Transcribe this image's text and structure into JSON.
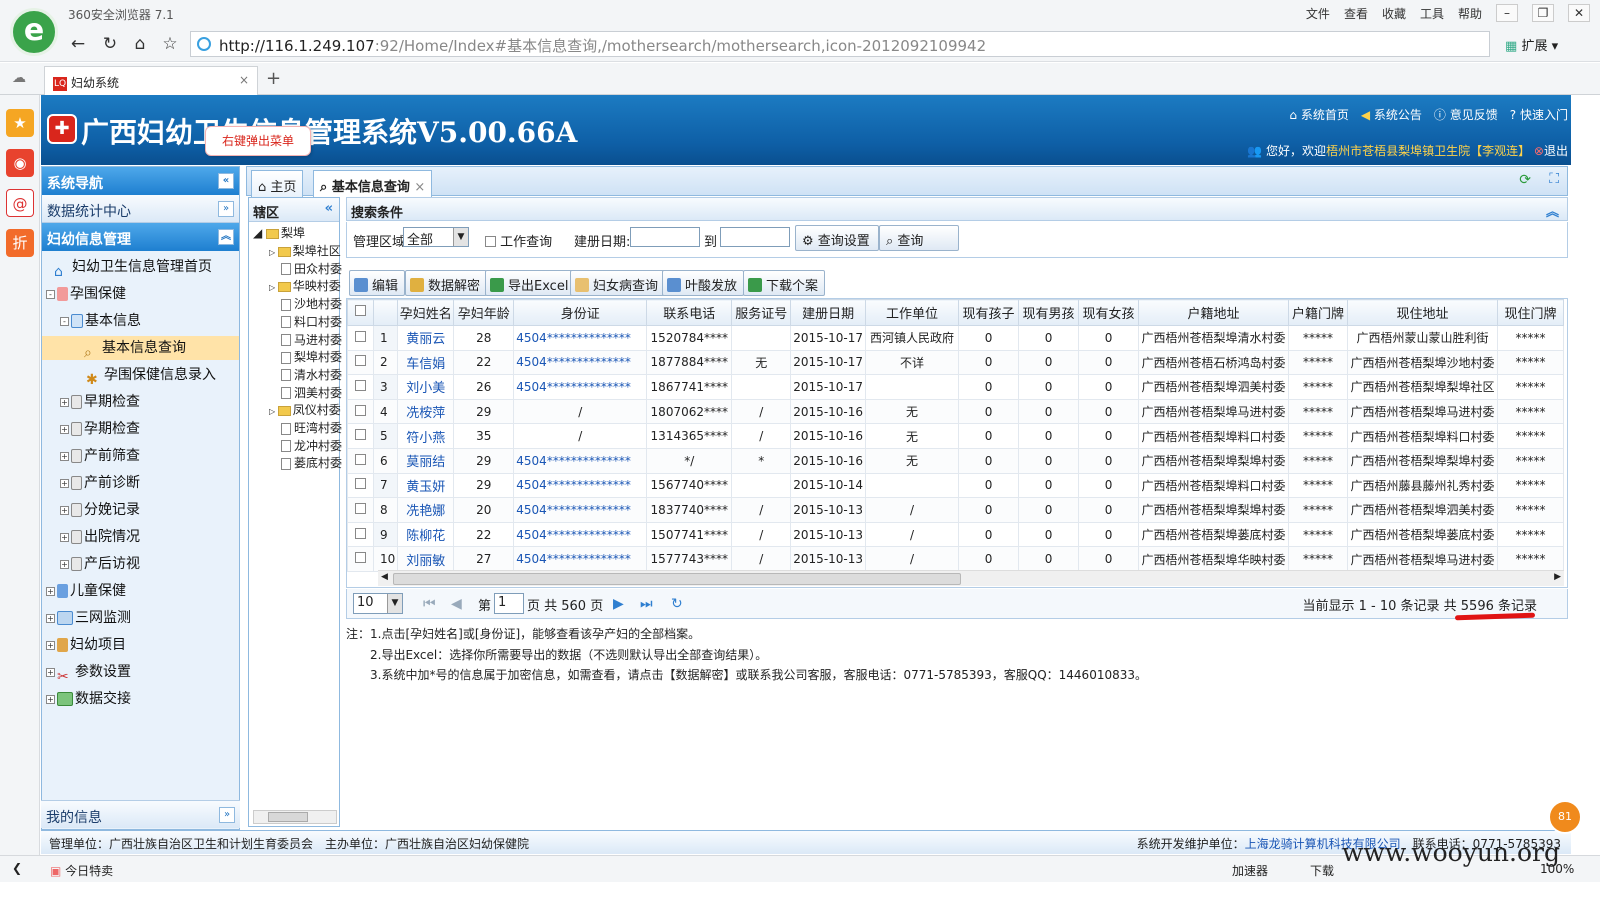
{
  "browser": {
    "title": "360安全浏览器 7.1",
    "menu": [
      "文件",
      "查看",
      "收藏",
      "工具",
      "帮助"
    ],
    "url_host": "http://116.1.249.107",
    "url_rest": ":92/Home/Index#基本信息查询,/mothersearch/mothersearch,icon-2012092109942",
    "ext_label": "扩展",
    "tab_label": "妇幼系统",
    "statusbar": {
      "left": "今日特卖",
      "items": [
        "加速器",
        "下载",
        "100%"
      ]
    }
  },
  "app": {
    "title": "广西妇幼卫生信息管理系统V5.00.66A",
    "context_tip": "右键弹出菜单",
    "top_links": [
      "系统首页",
      "系统公告",
      "意见反馈",
      "快速入门"
    ],
    "welcome_prefix": "您好，欢迎",
    "welcome_org": "梧州市苍梧县梨埠镇卫生院",
    "welcome_user": "【李观连】",
    "logout": "退出"
  },
  "nav": {
    "header": "系统导航",
    "stat_center": "数据统计中心",
    "section": "妇幼信息管理",
    "tree": [
      {
        "label": "妇幼卫生信息管理首页"
      },
      {
        "label": "孕围保健"
      },
      {
        "label": "基本信息"
      },
      {
        "label": "基本信息查询"
      },
      {
        "label": "孕围保健信息录入"
      },
      {
        "label": "早期检查"
      },
      {
        "label": "孕期检查"
      },
      {
        "label": "产前筛查"
      },
      {
        "label": "产前诊断"
      },
      {
        "label": "分娩记录"
      },
      {
        "label": "出院情况"
      },
      {
        "label": "产后访视"
      },
      {
        "label": "儿童保健"
      },
      {
        "label": "三网监测"
      },
      {
        "label": "妇幼项目"
      },
      {
        "label": "参数设置"
      },
      {
        "label": "数据交接"
      }
    ],
    "myinfo": "我的信息"
  },
  "tabs": {
    "home": "主页",
    "query": "基本信息查询"
  },
  "region": {
    "header": "辖区",
    "root": "梨埠",
    "nodes": [
      "梨埠社区",
      "田众村委",
      "华映村委",
      "沙地村委",
      "料口村委",
      "马进村委",
      "梨埠村委",
      "清水村委",
      "泗美村委",
      "凤仪村委",
      "旺湾村委",
      "龙冲村委",
      "蒌底村委"
    ]
  },
  "search": {
    "header": "搜索条件",
    "area_label": "管理区域:",
    "area_value": "全部",
    "work_label": "工作查询",
    "date_label": "建册日期:",
    "to_label": "到",
    "settings_btn": "查询设置",
    "query_btn": "查询"
  },
  "toolbar": {
    "edit": "编辑",
    "decrypt": "数据解密",
    "export": "导出Excel",
    "gyn": "妇女病查询",
    "folic": "叶酸发放",
    "download": "下载个案"
  },
  "grid": {
    "columns": [
      "孕妇姓名",
      "孕妇年龄",
      "身份证",
      "联系电话",
      "服务证号",
      "建册日期",
      "工作单位",
      "现有孩子",
      "现有男孩",
      "现有女孩",
      "户籍地址",
      "户籍门牌",
      "现住地址",
      "现住门牌"
    ],
    "rows": [
      [
        "1",
        "黄丽云",
        "28",
        "4504**************",
        "1520784****",
        "",
        "2015-10-17",
        "西河镇人民政府",
        "0",
        "0",
        "0",
        "广西梧州苍梧梨埠清水村委",
        "*****",
        "广西梧州蒙山蒙山胜利街",
        "*****"
      ],
      [
        "2",
        "车信娟",
        "22",
        "4504**************",
        "1877884****",
        "无",
        "2015-10-17",
        "不详",
        "0",
        "0",
        "0",
        "广西梧州苍梧石桥鸿岛村委",
        "*****",
        "广西梧州苍梧梨埠沙地村委",
        "*****"
      ],
      [
        "3",
        "刘小美",
        "26",
        "4504**************",
        "1867741****",
        "",
        "2015-10-17",
        "",
        "0",
        "0",
        "0",
        "广西梧州苍梧梨埠泗美村委",
        "*****",
        "广西梧州苍梧梨埠梨埠社区",
        "*****"
      ],
      [
        "4",
        "冼桉萍",
        "29",
        "/",
        "1807062****",
        "/",
        "2015-10-16",
        "无",
        "0",
        "0",
        "0",
        "广西梧州苍梧梨埠马进村委",
        "*****",
        "广西梧州苍梧梨埠马进村委",
        "*****"
      ],
      [
        "5",
        "符小燕",
        "35",
        "/",
        "1314365****",
        "/",
        "2015-10-16",
        "无",
        "0",
        "0",
        "0",
        "广西梧州苍梧梨埠料口村委",
        "*****",
        "广西梧州苍梧梨埠料口村委",
        "*****"
      ],
      [
        "6",
        "莫丽结",
        "29",
        "4504**************",
        "*/",
        "*",
        "2015-10-16",
        "无",
        "0",
        "0",
        "0",
        "广西梧州苍梧梨埠梨埠村委",
        "*****",
        "广西梧州苍梧梨埠梨埠村委",
        "*****"
      ],
      [
        "7",
        "黄玉妍",
        "29",
        "4504**************",
        "1567740****",
        "",
        "2015-10-14",
        "",
        "0",
        "0",
        "0",
        "广西梧州苍梧梨埠料口村委",
        "*****",
        "广西梧州藤县藤州礼秀村委",
        "*****"
      ],
      [
        "8",
        "冼艳娜",
        "20",
        "4504**************",
        "1837740****",
        "/",
        "2015-10-13",
        "/",
        "0",
        "0",
        "0",
        "广西梧州苍梧梨埠梨埠村委",
        "*****",
        "广西梧州苍梧梨埠泗美村委",
        "*****"
      ],
      [
        "9",
        "陈柳花",
        "22",
        "4504**************",
        "1507741****",
        "/",
        "2015-10-13",
        "/",
        "0",
        "0",
        "0",
        "广西梧州苍梧梨埠蒌底村委",
        "*****",
        "广西梧州苍梧梨埠蒌底村委",
        "*****"
      ],
      [
        "10",
        "刘丽敏",
        "27",
        "4504**************",
        "1577743****",
        "/",
        "2015-10-13",
        "/",
        "0",
        "0",
        "0",
        "广西梧州苍梧梨埠华映村委",
        "*****",
        "广西梧州苍梧梨埠马进村委",
        "*****"
      ]
    ]
  },
  "pager": {
    "page_size": "10",
    "page_prefix": "第",
    "page_value": "1",
    "page_suffix": "页 共 560 页",
    "summary": "当前显示 1 - 10 条记录 共 5596 条记录"
  },
  "notes": [
    "注：1.点击[孕妇姓名]或[身份证]，能够查看该孕产妇的全部档案。",
    "2.导出Excel：选择你所需要导出的数据（不选则默认导出全部查询结果）。",
    "3.系统中加*号的信息属于加密信息，如需查看，请点击【数据解密】或联系我公司客服，客服电话：0771-5785393，客服QQ：1446010833。"
  ],
  "footer": {
    "left": "管理单位：广西壮族自治区卫生和计划生育委员会　主办单位：广西壮族自治区妇幼保健院",
    "dev_label": "系统开发维护单位：",
    "dev_org": "上海龙骑计算机科技有限公司",
    "phone": "联系电话：0771-5785393"
  },
  "watermark": "www.wooyun.org",
  "float_badge": "81",
  "colors": {
    "header_blue": "#1c7bc2",
    "link_blue": "#1a56b5",
    "selection": "#ffe3a8",
    "red_mark": "#e01414"
  }
}
